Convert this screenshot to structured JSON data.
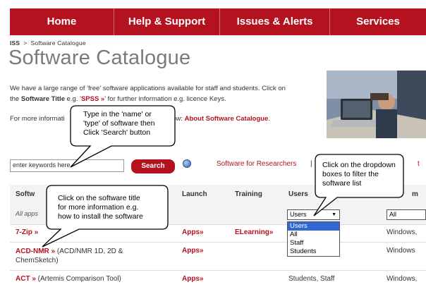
{
  "nav": [
    {
      "label": "Home",
      "width": 148
    },
    {
      "label": "Help & Support",
      "width": 150
    },
    {
      "label": "Issues & Alerts",
      "width": 156
    },
    {
      "label": "Services",
      "width": 136
    }
  ],
  "breadcrumb": {
    "root": "ISS",
    "separator": ">",
    "current": "Software Catalogue"
  },
  "page_title": "Software Catalogue",
  "intro": {
    "line1": "We have a large range of 'free' software applications available for staff and students. Click on",
    "line2_pre": "the ",
    "line2_bold": "Software Title",
    "line2_mid": " e.g. '",
    "line2_link": "SPSS »",
    "line2_post": "' for further information e.g. licence Keys."
  },
  "more": {
    "pre": "For more informati",
    "post": "follow: ",
    "link": "About Software Catalogue",
    "end": "."
  },
  "search": {
    "value": "enter keywords here",
    "button": "Search"
  },
  "links": {
    "researchers": "Software for Researchers",
    "pipe": "|",
    "cut": "t"
  },
  "table": {
    "headers": {
      "software": "Softw",
      "launch": "Launch",
      "training": "Training",
      "users": "Users",
      "os": "m"
    },
    "all_apps": "All apps",
    "users_filter": "Users",
    "os_filter": "All",
    "users_options": [
      "Users",
      "All",
      "Staff",
      "Students"
    ],
    "rows": [
      {
        "title": "7-Zip »",
        "desc": "",
        "launch": "Apps»",
        "training": "ELearning»",
        "users": "",
        "os": "Windows,"
      },
      {
        "title": "ACD-NMR »",
        "desc": " (ACD/NMR 1D, 2D &",
        "desc2": "ChemSketch)",
        "launch": "Apps»",
        "training": "",
        "users": "",
        "os": "Windows"
      },
      {
        "title": "ACT »",
        "desc": " (Artemis Comparison Tool)",
        "launch": "Apps»",
        "training": "",
        "users": "Students, Staff",
        "os": "Windows,"
      }
    ]
  },
  "callouts": {
    "search": [
      "Type in the 'name' or",
      "'type' of software then",
      "Click 'Search' button"
    ],
    "dropdown": [
      "Click on the dropdown",
      "boxes to filter the",
      "software list"
    ],
    "title": [
      "Click on the software title",
      "for more information e.g.",
      "how to install the software"
    ]
  },
  "colors": {
    "brand_red": "#b4121e",
    "select_blue": "#3168d6"
  }
}
